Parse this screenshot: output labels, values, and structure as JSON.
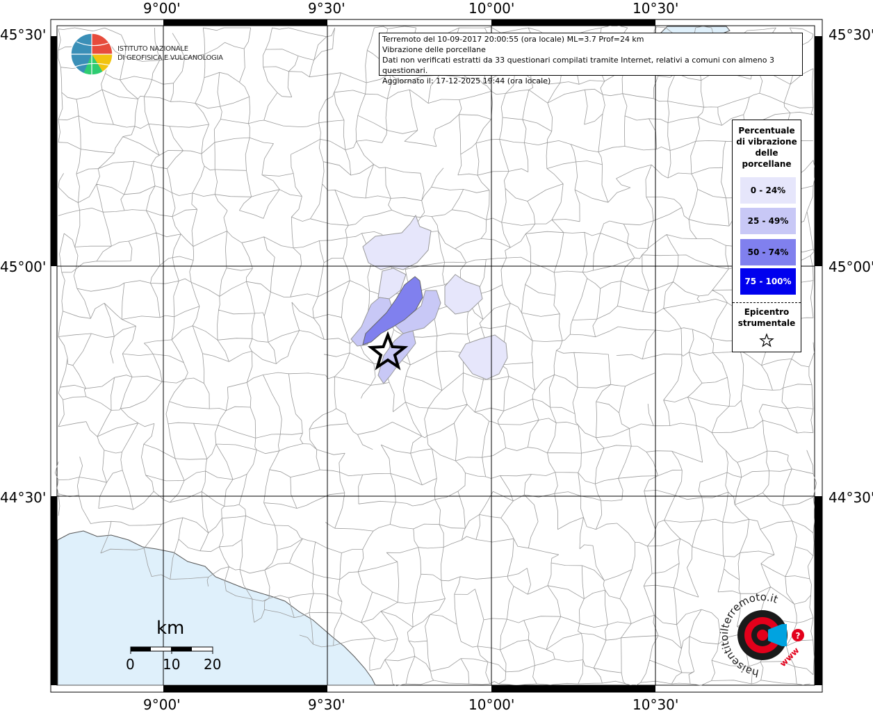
{
  "header": {
    "line1": "Terremoto del 10-09-2017 20:00:55 (ora locale) ML=3.7 Prof=24 km",
    "line2": "Vibrazione delle porcellane",
    "line3": "Dati non verificati estratti da 33 questionari compilati tramite Internet, relativi a comuni con almeno 3 questionari.",
    "line4": "Aggiornato il: 17-12-2025 19:44 (ora locale)"
  },
  "axes": {
    "lon_top": [
      "9°00'",
      "9°30'",
      "10°00'",
      "10°30'"
    ],
    "lon_bottom": [
      "9°00'",
      "9°30'",
      "10°00'",
      "10°30'"
    ],
    "lat_left": [
      "45°30'",
      "45°00'",
      "44°30'"
    ],
    "lat_right": [
      "45°30'",
      "45°00'",
      "44°30'"
    ]
  },
  "logo": {
    "line1": "ISTITUTO NAZIONALE",
    "line2": "DI GEOFISICA E VULCANOLOGIA"
  },
  "legend": {
    "title_l1": "Percentuale",
    "title_l2": "di vibrazione",
    "title_l3": "delle",
    "title_l4": "porcellane",
    "classes": [
      {
        "label": "0 - 24%",
        "color": "#e6e6fb",
        "text_color": "#000000"
      },
      {
        "label": "25 - 49%",
        "color": "#c8c8f6",
        "text_color": "#000000"
      },
      {
        "label": "50 - 74%",
        "color": "#8080ee",
        "text_color": "#000000"
      },
      {
        "label": "75 - 100%",
        "color": "#0000ee",
        "text_color": "#ffffff"
      }
    ],
    "epicenter_l1": "Epicentro",
    "epicenter_l2": "strumentale",
    "epicenter_icon": "star-icon"
  },
  "scalebar": {
    "unit": "km",
    "ticks": [
      "0",
      "10",
      "20"
    ]
  },
  "brand": {
    "text": "haisentitoilterremoto.it",
    "url": "www",
    "colors": {
      "red": "#e3001b",
      "blue": "#00a3e0",
      "dark": "#1a1a1a"
    }
  },
  "colors": {
    "sea": "#dff0fb",
    "boundary": "#9a9a9a",
    "grid": "#000000"
  }
}
